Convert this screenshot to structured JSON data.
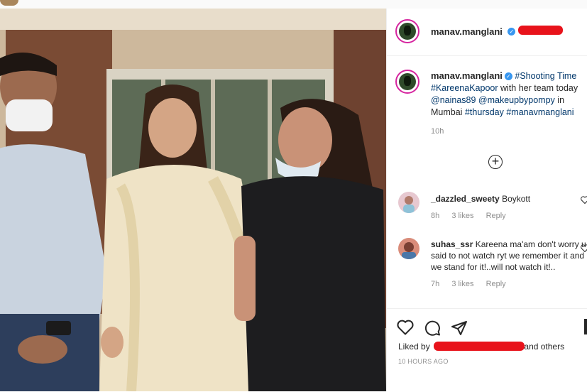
{
  "post": {
    "username": "manav.manglani",
    "verified_glyph": "✓",
    "caption_parts": {
      "tag1": "#Shooting",
      "word1": "Time",
      "tag2": "#KareenaKapoor",
      "text1": "with her team today",
      "mention1": "@nainas89",
      "mention2": "@makeupbypompy",
      "text2": "in Mumbai",
      "tag3": "#thursday",
      "tag4": "#manavmanglani"
    },
    "age": "10h",
    "time_ago": "10 HOURS AGO",
    "liked_by_prefix": "Liked by",
    "liked_by_suffix": "and others",
    "separator": "•"
  },
  "comments": [
    {
      "username": "_dazzled_sweety",
      "text": "Boykott",
      "age": "8h",
      "likes": "3 likes",
      "reply": "Reply"
    },
    {
      "username": "suhas_ssr",
      "text": "Kareena ma'am don't worry u said to not watch ryt we remember it and we stand for it!..will not watch it!..",
      "age": "7h",
      "likes": "3 likes",
      "reply": "Reply"
    }
  ],
  "icons": {
    "add": "plus-circle-icon",
    "like": "heart-icon",
    "comment": "comment-icon",
    "share": "paper-plane-icon",
    "save": "bookmark-icon",
    "comment_like": "heart-icon"
  },
  "colors": {
    "redaction": "#e8131b",
    "hashtag": "#00376b",
    "verified": "#3897f0",
    "story_ring": "#d6249f"
  }
}
